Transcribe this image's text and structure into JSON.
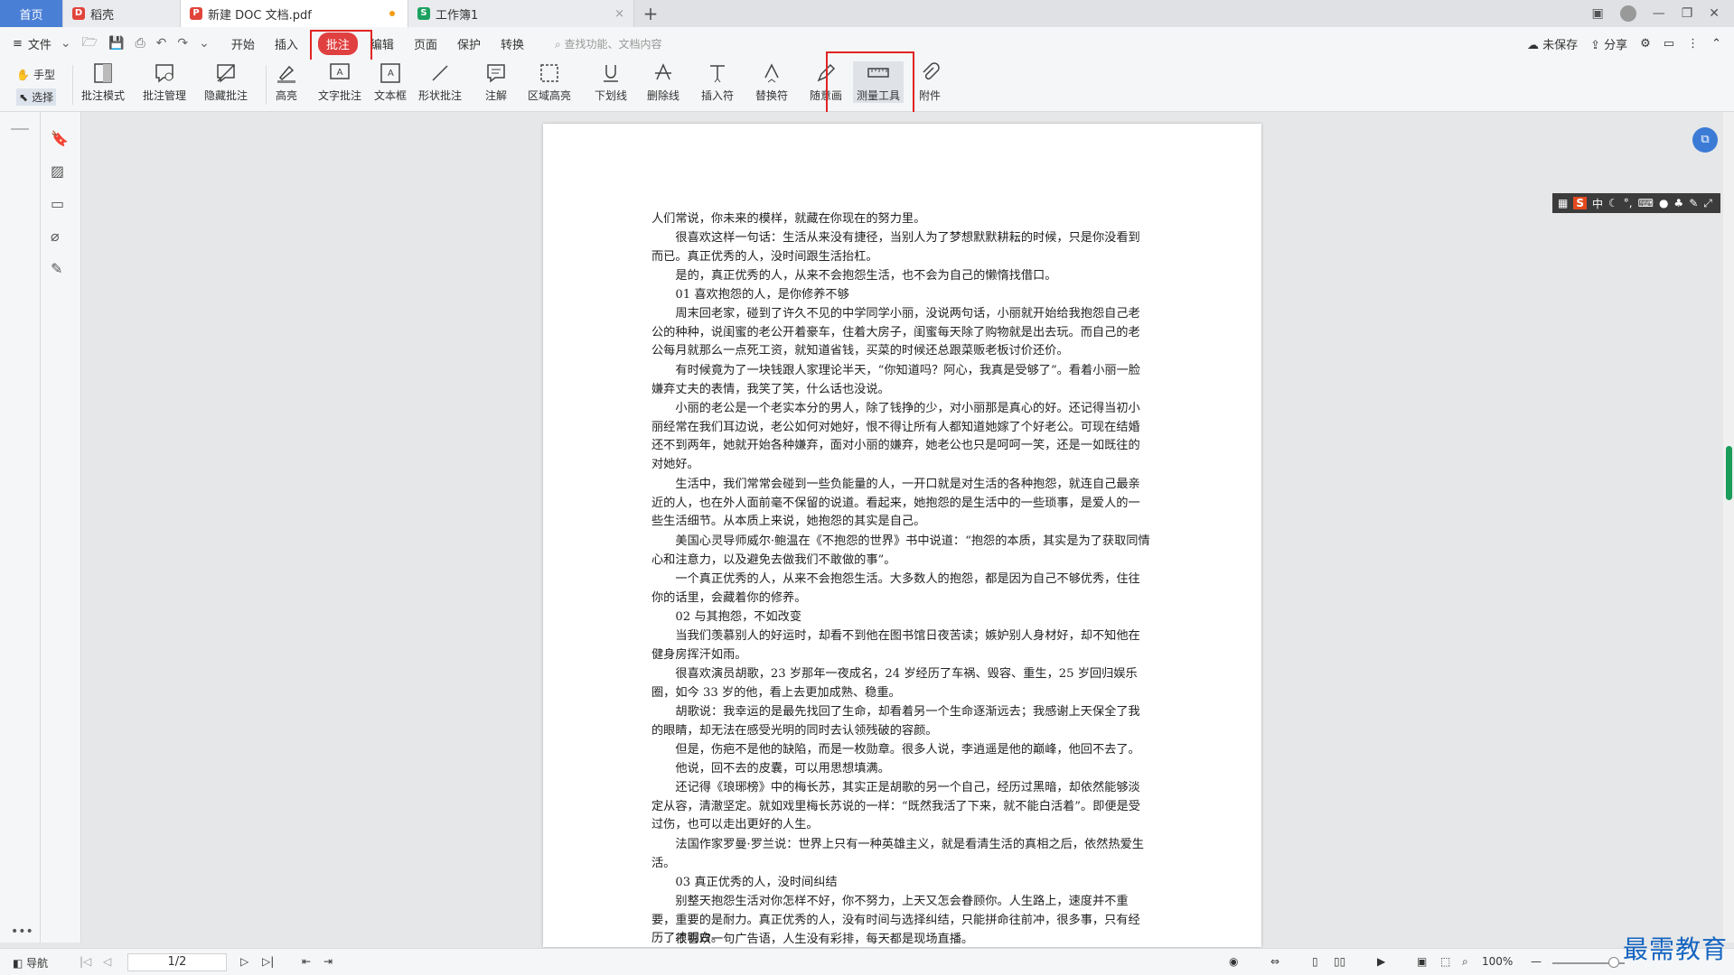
{
  "tabs": {
    "home": "首页",
    "t1": "稻壳",
    "t2": "新建 DOC 文档.pdf",
    "t3": "工作簿1",
    "new_tab": "+"
  },
  "menu": {
    "file": "文件",
    "items": [
      "开始",
      "插入",
      "批注",
      "编辑",
      "页面",
      "保护",
      "转换"
    ],
    "active": "批注",
    "search_placeholder": "查找功能、文档内容",
    "unsaved": "未保存",
    "share": "分享"
  },
  "ribbon": {
    "hand": "手型",
    "select": "选择",
    "buttons": [
      "批注模式",
      "批注管理",
      "隐藏批注",
      "高亮",
      "文字批注",
      "文本框",
      "形状批注",
      "注解",
      "区域高亮",
      "下划线",
      "删除线",
      "插入符",
      "替换符",
      "随意画",
      "测量工具",
      "附件"
    ]
  },
  "document": {
    "paragraphs": [
      "人们常说，你未来的模样，就藏在你现在的努力里。",
      "很喜欢这样一句话：生活从来没有捷径，当别人为了梦想默默耕耘的时候，只是你没看到而已。真正优秀的人，没时间跟生活抬杠。",
      "是的，真正优秀的人，从来不会抱怨生活，也不会为自己的懒惰找借口。",
      "01 喜欢抱怨的人，是你修养不够",
      "周末回老家，碰到了许久不见的中学同学小丽，没说两句话，小丽就开始给我抱怨自己老公的种种，说闺蜜的老公开着豪车，住着大房子，闺蜜每天除了购物就是出去玩。而自己的老公每月就那么一点死工资，就知道省钱，买菜的时候还总跟菜贩老板讨价还价。",
      "有时候竟为了一块钱跟人家理论半天，“你知道吗？阿心，我真是受够了”。看着小丽一脸嫌弃丈夫的表情，我笑了笑，什么话也没说。",
      "小丽的老公是一个老实本分的男人，除了钱挣的少，对小丽那是真心的好。还记得当初小丽经常在我们耳边说，老公如何对她好，恨不得让所有人都知道她嫁了个好老公。可现在结婚还不到两年，她就开始各种嫌弃，面对小丽的嫌弃，她老公也只是呵呵一笑，还是一如既往的对她好。",
      "生活中，我们常常会碰到一些负能量的人，一开口就是对生活的各种抱怨，就连自己最亲近的人，也在外人面前毫不保留的说道。看起来，她抱怨的是生活中的一些琐事，是爱人的一些生活细节。从本质上来说，她抱怨的其实是自己。",
      "美国心灵导师威尔·鲍温在《不抱怨的世界》书中说道：“抱怨的本质，其实是为了获取同情心和注意力，以及避免去做我们不敢做的事”。",
      "一个真正优秀的人，从来不会抱怨生活。大多数人的抱怨，都是因为自己不够优秀，住往你的话里，会藏着你的修养。",
      "02 与其抱怨，不如改变",
      "当我们羡慕别人的好运时，却看不到他在图书馆日夜苦读；嫉妒别人身材好，却不知他在健身房挥汗如雨。",
      "很喜欢演员胡歌，23 岁那年一夜成名，24 岁经历了车祸、毁容、重生，25 岁回归娱乐圈，如今 33 岁的他，看上去更加成熟、稳重。",
      "胡歌说：我幸运的是最先找回了生命，却看着另一个生命逐渐远去；我感谢上天保全了我的眼睛，却无法在感受光明的同时去认领残破的容颜。",
      "但是，伤疤不是他的缺陷，而是一枚勋章。很多人说，李逍遥是他的巅峰，他回不去了。",
      "他说，回不去的皮囊，可以用思想填满。",
      "还记得《琅琊榜》中的梅长苏，其实正是胡歌的另一个自己，经历过黑暗，却依然能够淡定从容，清澈坚定。就如戏里梅长苏说的一样：“既然我活了下来，就不能白活着”。即便是受过伤，也可以走出更好的人生。",
      "法国作家罗曼·罗兰说：世界上只有一种英雄主义，就是看清生活的真相之后，依然热爱生活。",
      "03 真正优秀的人，没时间纠结",
      "别整天抱怨生活对你怎样不好，你不努力，上天又怎会眷顾你。人生路上，速度并不重要，重要的是耐力。真正优秀的人，没有时间与选择纠结，只能拼命往前冲，很多事，只有经历了才明白。",
      "很喜欢一句广告语，人生没有彩排，每天都是现场直播。"
    ]
  },
  "ime": {
    "label": "中"
  },
  "status": {
    "nav": "导航",
    "page": "1/2",
    "zoom": "100%"
  },
  "watermark": "最需教育",
  "colors": {
    "accent": "#e04040",
    "highlight_box": "#e02424",
    "home_tab": "#4a7fd6"
  }
}
